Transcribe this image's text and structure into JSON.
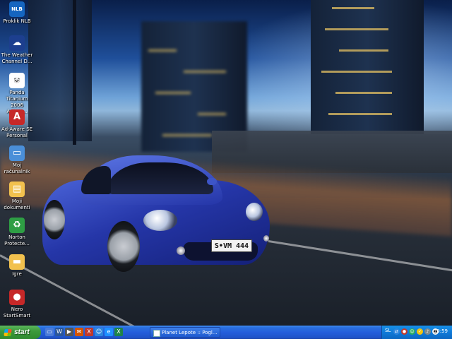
{
  "desktop_icons": [
    {
      "label": "Proklik NLB",
      "icon": "bank-icon",
      "color": "#1565c0",
      "glyph": "NLB"
    },
    {
      "label": "The Weather Channel D...",
      "icon": "weather-icon",
      "color": "#1d3f8f",
      "glyph": "☁"
    },
    {
      "label": "Panda Titanium 2006 Antivir...",
      "icon": "panda-icon",
      "color": "#ffffff",
      "glyph": "🐼"
    },
    {
      "label": "Ad-Aware SE Personal",
      "icon": "adaware-icon",
      "color": "#c62828",
      "glyph": "A"
    },
    {
      "label": "Moj računalnik",
      "icon": "my-computer-icon",
      "color": "#4a8fd8",
      "glyph": "▭"
    },
    {
      "label": "Moji dokumenti",
      "icon": "my-documents-icon",
      "color": "#f2c14e",
      "glyph": "▤"
    },
    {
      "label": "Norton Protecte...",
      "icon": "recycle-bin-icon",
      "color": "#2e9e44",
      "glyph": "♻"
    },
    {
      "label": "Igre",
      "icon": "folder-icon",
      "color": "#f2c14e",
      "glyph": "▬"
    },
    {
      "label": "Nero StartSmart",
      "icon": "nero-icon",
      "color": "#c62828",
      "glyph": "●"
    }
  ],
  "car": {
    "plate": "S•VM 444"
  },
  "taskbar": {
    "start_label": "start",
    "quick_launch": [
      {
        "icon": "desktop-icon",
        "color": "#4a7bd8",
        "glyph": "▭"
      },
      {
        "icon": "word-icon",
        "color": "#2b579a",
        "glyph": "W"
      },
      {
        "icon": "media-icon",
        "color": "#555555",
        "glyph": "▶"
      },
      {
        "icon": "outlook-icon",
        "color": "#d35400",
        "glyph": "✉"
      },
      {
        "icon": "excel-icon",
        "color": "#c0392b",
        "glyph": "X"
      },
      {
        "icon": "messenger-icon",
        "color": "#2e86de",
        "glyph": "☺"
      },
      {
        "icon": "ie-icon",
        "color": "#1e90ff",
        "glyph": "e"
      },
      {
        "icon": "spreadsheet-icon",
        "color": "#1e8449",
        "glyph": "X"
      }
    ],
    "window_button": "Planet Lepote :: Pogl...",
    "language": "SL",
    "tray_icons": [
      {
        "icon": "network-icon",
        "color": "#2e86de",
        "glyph": "⇄"
      },
      {
        "icon": "antivirus-icon",
        "color": "#c0392b",
        "glyph": "●"
      },
      {
        "icon": "messenger-tray-icon",
        "color": "#27ae60",
        "glyph": "☺"
      },
      {
        "icon": "norton-tray-icon",
        "color": "#f1c40f",
        "glyph": "✓"
      },
      {
        "icon": "speaker-icon",
        "color": "#7f8c8d",
        "glyph": "♪"
      },
      {
        "icon": "panda-tray-icon",
        "color": "#ecf0f1",
        "glyph": "●"
      }
    ],
    "clock": "10:59"
  }
}
